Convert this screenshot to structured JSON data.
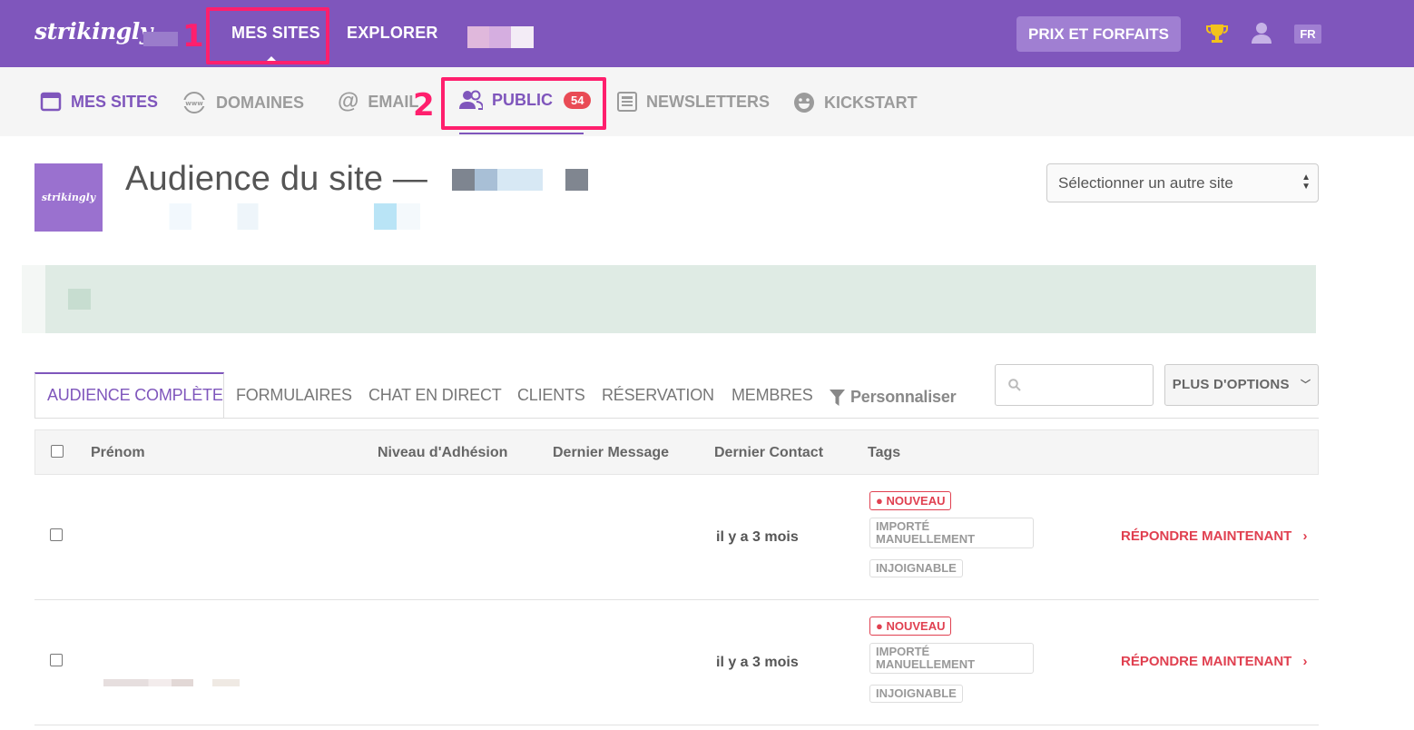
{
  "topbar": {
    "logo": "strikingly",
    "links": {
      "my_sites": "MES SITES",
      "explore": "EXPLORER"
    },
    "pricing_label": "PRIX ET FORFAITS",
    "lang": "FR",
    "icons": [
      "trophy-icon",
      "user-icon"
    ]
  },
  "annotations": [
    "1",
    "2"
  ],
  "subnav": {
    "items": [
      {
        "label": "MES SITES",
        "icon": "calendar-icon"
      },
      {
        "label": "DOMAINES",
        "icon": "www-icon"
      },
      {
        "label": "EMAIL",
        "icon": "at-icon"
      },
      {
        "label": "PUBLIC",
        "icon": "people-icon",
        "badge": "54"
      },
      {
        "label": "NEWSLETTERS",
        "icon": "newsletter-icon"
      },
      {
        "label": "KICKSTART",
        "icon": "smiley-icon"
      }
    ]
  },
  "site": {
    "thumb_label": "strikingly",
    "title": "Audience du site —",
    "select_label": "Sélectionner un autre site"
  },
  "tabs": {
    "items": [
      "AUDIENCE COMPLÈTE",
      "FORMULAIRES",
      "CHAT EN DIRECT",
      "CLIENTS",
      "RÉSERVATION",
      "MEMBRES"
    ],
    "customize": "Personnaliser",
    "more_options": "PLUS D'OPTIONS"
  },
  "table": {
    "headers": {
      "first_name": "Prénom",
      "membership": "Niveau d'Adhésion",
      "last_message": "Dernier Message",
      "last_contact": "Dernier Contact",
      "tags": "Tags"
    },
    "rows": [
      {
        "last_contact": "il y a 3 mois",
        "tags": [
          "NOUVEAU",
          "IMPORTÉ MANUELLEMENT",
          "INJOIGNABLE"
        ],
        "action": "RÉPONDRE MAINTENANT"
      },
      {
        "last_contact": "il y a 3 mois",
        "tags": [
          "NOUVEAU",
          "IMPORTÉ MANUELLEMENT",
          "INJOIGNABLE"
        ],
        "action": "RÉPONDRE MAINTENANT"
      }
    ]
  },
  "colors": {
    "brand": "#7f56bc",
    "annotation": "#ff1f6d",
    "danger": "#e04050",
    "badge": "#e94b55"
  }
}
